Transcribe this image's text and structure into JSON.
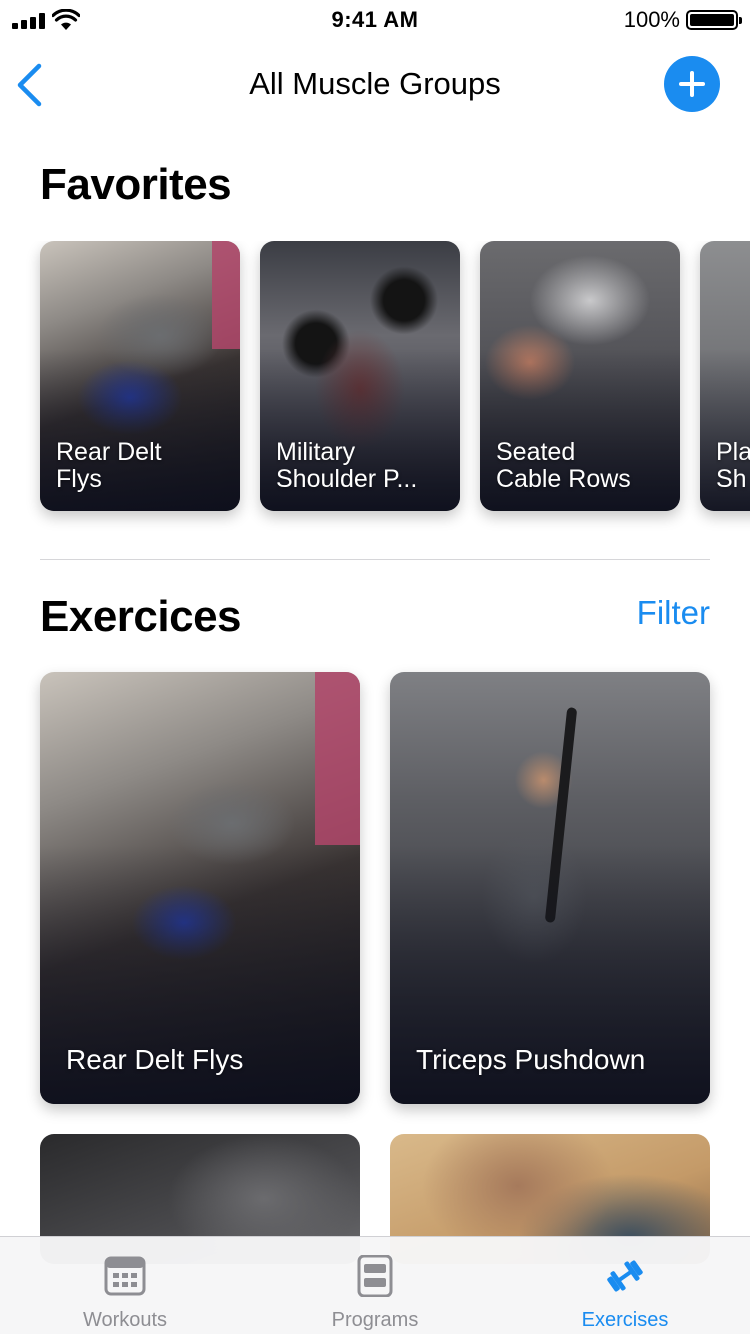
{
  "status_bar": {
    "time": "9:41 AM",
    "battery": "100%"
  },
  "nav": {
    "title": "All Muscle Groups"
  },
  "favorites": {
    "title": "Favorites",
    "items": [
      {
        "line1": "Rear Delt",
        "line2": "Flys"
      },
      {
        "line1": "Military",
        "line2": "Shoulder P..."
      },
      {
        "line1": "Seated",
        "line2": "Cable Rows"
      },
      {
        "line1": "Pla",
        "line2": "Sh"
      }
    ]
  },
  "exercises": {
    "title": "Exercices",
    "filter_label": "Filter",
    "items": [
      {
        "label": "Rear Delt Flys"
      },
      {
        "label": "Triceps Pushdown"
      }
    ]
  },
  "tabs": [
    {
      "label": "Workouts",
      "icon": "calendar-icon"
    },
    {
      "label": "Programs",
      "icon": "document-icon"
    },
    {
      "label": "Exercises",
      "icon": "dumbbell-icon",
      "active": true
    }
  ],
  "colors": {
    "accent": "#1a8cf0",
    "inactive": "#8e8e93"
  }
}
